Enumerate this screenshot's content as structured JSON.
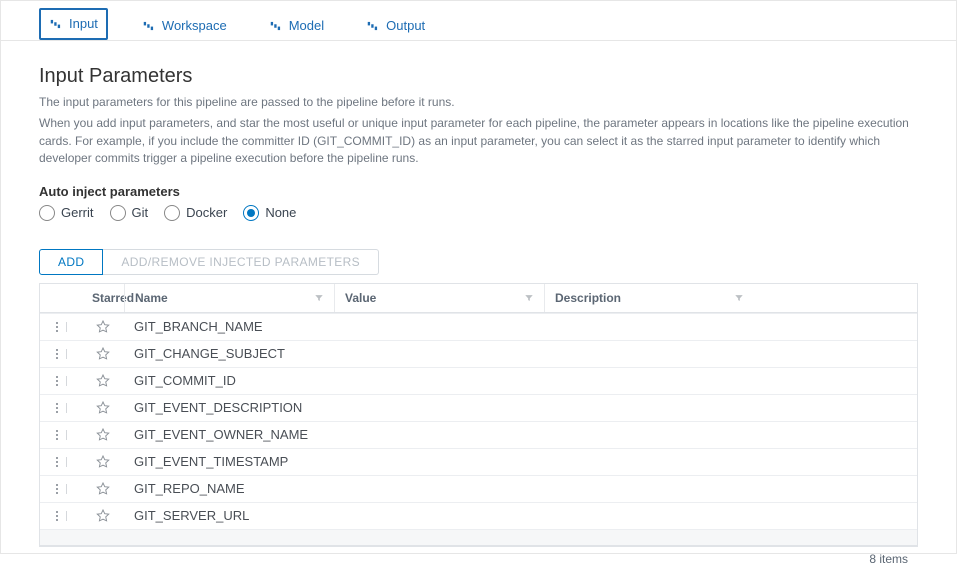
{
  "tabs": [
    {
      "label": "Input",
      "active": true
    },
    {
      "label": "Workspace",
      "active": false
    },
    {
      "label": "Model",
      "active": false
    },
    {
      "label": "Output",
      "active": false
    }
  ],
  "title": "Input Parameters",
  "subtitle1": "The input parameters for this pipeline are passed to the pipeline before it runs.",
  "subtitle2": "When you add input parameters, and star the most useful or unique input parameter for each pipeline, the parameter appears in locations like the pipeline execution cards. For example, if you include the committer ID (GIT_COMMIT_ID) as an input parameter, you can select it as the starred input parameter to identify which developer commits trigger a pipeline execution before the pipeline runs.",
  "autoInject": {
    "label": "Auto inject parameters",
    "options": [
      "Gerrit",
      "Git",
      "Docker",
      "None"
    ],
    "selected": "None"
  },
  "buttons": {
    "add": "ADD",
    "addRemove": "ADD/REMOVE INJECTED PARAMETERS"
  },
  "columns": {
    "starred": "Starred",
    "name": "Name",
    "value": "Value",
    "description": "Description"
  },
  "rows": [
    {
      "name": "GIT_BRANCH_NAME",
      "value": "",
      "description": ""
    },
    {
      "name": "GIT_CHANGE_SUBJECT",
      "value": "",
      "description": ""
    },
    {
      "name": "GIT_COMMIT_ID",
      "value": "",
      "description": ""
    },
    {
      "name": "GIT_EVENT_DESCRIPTION",
      "value": "",
      "description": ""
    },
    {
      "name": "GIT_EVENT_OWNER_NAME",
      "value": "",
      "description": ""
    },
    {
      "name": "GIT_EVENT_TIMESTAMP",
      "value": "",
      "description": ""
    },
    {
      "name": "GIT_REPO_NAME",
      "value": "",
      "description": ""
    },
    {
      "name": "GIT_SERVER_URL",
      "value": "",
      "description": ""
    }
  ],
  "footer": {
    "count": "8 items"
  }
}
